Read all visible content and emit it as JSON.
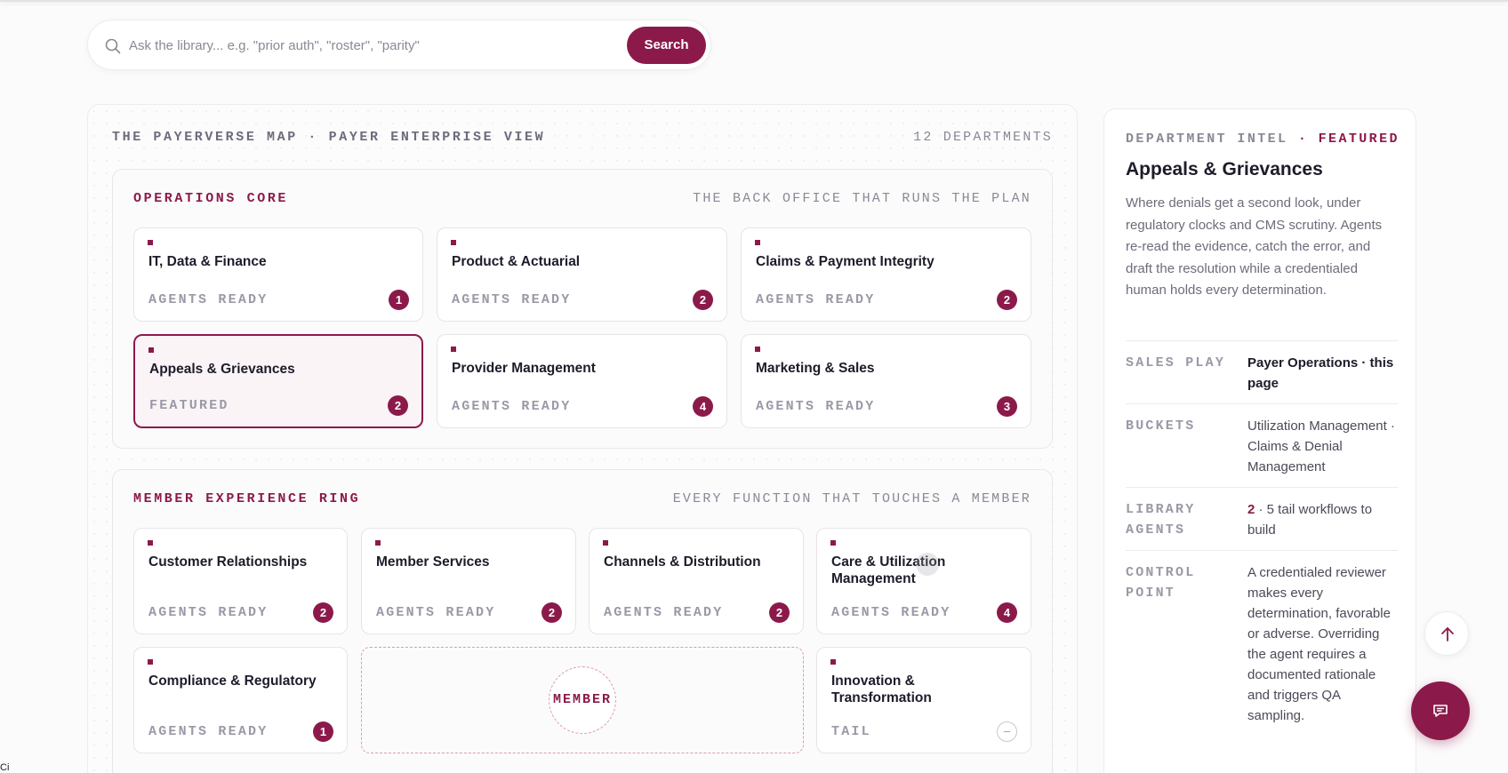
{
  "search": {
    "placeholder": "Ask the library... e.g. \"prior auth\", \"roster\", \"parity\"",
    "value": "",
    "button_label": "Search"
  },
  "map": {
    "title": "THE PAYERVERSE MAP · PAYER ENTERPRISE VIEW",
    "count": "12 DEPARTMENTS",
    "sections": [
      {
        "title": "OPERATIONS CORE",
        "subtitle": "THE BACK OFFICE THAT RUNS THE PLAN",
        "cards": [
          {
            "name": "IT, Data & Finance",
            "status": "AGENTS READY",
            "agents": "1"
          },
          {
            "name": "Product & Actuarial",
            "status": "AGENTS READY",
            "agents": "2"
          },
          {
            "name": "Claims & Payment Integrity",
            "status": "AGENTS READY",
            "agents": "2"
          },
          {
            "name": "Appeals & Grievances",
            "status": "FEATURED",
            "agents": "2"
          },
          {
            "name": "Provider Management",
            "status": "AGENTS READY",
            "agents": "4"
          },
          {
            "name": "Marketing & Sales",
            "status": "AGENTS READY",
            "agents": "3"
          }
        ]
      },
      {
        "title": "MEMBER EXPERIENCE RING",
        "subtitle": "EVERY FUNCTION THAT TOUCHES A MEMBER",
        "center_label": "MEMBER",
        "cards": [
          {
            "name": "Customer Relationships",
            "status": "AGENTS READY",
            "agents": "2"
          },
          {
            "name": "Member Services",
            "status": "AGENTS READY",
            "agents": "2"
          },
          {
            "name": "Channels & Distribution",
            "status": "AGENTS READY",
            "agents": "2"
          },
          {
            "name": "Care & Utilization Management",
            "status": "AGENTS READY",
            "agents": "4"
          },
          {
            "name": "Compliance & Regulatory",
            "status": "AGENTS READY",
            "agents": "1"
          },
          {
            "name": "Innovation & Transformation",
            "status": "TAIL",
            "agents": "–"
          }
        ]
      }
    ]
  },
  "intel": {
    "eyebrow": "DEPARTMENT INTEL",
    "eyebrow_sep": " · ",
    "featured": "FEATURED",
    "title": "Appeals & Grievances",
    "description": "Where denials get a second look, under regulatory clocks and CMS scrutiny. Agents re-read the evidence, catch the error, and draft the resolution while a credentialed human holds every determination.",
    "rows": [
      {
        "key": "SALES PLAY",
        "value": "Payer Operations · this page"
      },
      {
        "key": "BUCKETS",
        "value": "Utilization Management · Claims & Denial Management"
      },
      {
        "key": "LIBRARY AGENTS",
        "value_num": "2",
        "value_rest": " · 5 tail workflows to build"
      },
      {
        "key": "CONTROL POINT",
        "value": "A credentialed reviewer makes every determination, favorable or adverse. Overriding the agent requires a documented rationale and triggers QA sampling."
      }
    ]
  },
  "edge_text": "Ci",
  "colors": {
    "accent": "#8b1a4a",
    "muted": "#8a8996",
    "featured_bg": "#fbf4f7"
  },
  "icons": {
    "search": "search-icon",
    "scroll_top": "arrow-up-icon",
    "chat": "chat-icon"
  }
}
